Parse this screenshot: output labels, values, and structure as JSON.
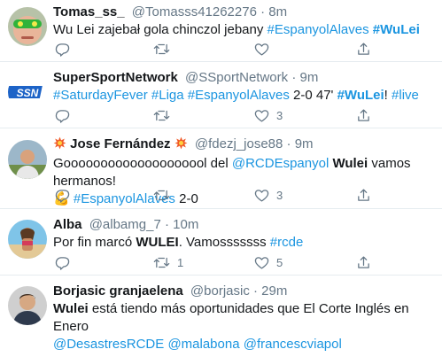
{
  "tweets": [
    {
      "name": "Tomas_ss_",
      "handle": "@Tomasss41262276",
      "time": "8m",
      "text": [
        {
          "t": "Wu Lei zajebał gola chinczol jebany "
        },
        {
          "t": "#EspanyolAlaves",
          "link": true
        },
        {
          "t": " "
        },
        {
          "t": "#WuLei",
          "link": true,
          "bold": true
        }
      ],
      "counts": {
        "reply": "",
        "retweet": "",
        "like": ""
      },
      "avatar": "avatar-green-mask"
    },
    {
      "name": "SuperSportNetwork",
      "handle": "@SSportNetwork",
      "time": "9m",
      "text": [
        {
          "t": "#SaturdayFever",
          "link": true
        },
        {
          "t": " "
        },
        {
          "t": "#Liga",
          "link": true
        },
        {
          "t": " "
        },
        {
          "t": "#EspanyolAlaves",
          "link": true
        },
        {
          "t": " 2-0 47' "
        },
        {
          "t": "#WuLei",
          "link": true,
          "bold": true
        },
        {
          "t": "! "
        },
        {
          "t": "#live",
          "link": true
        }
      ],
      "counts": {
        "reply": "",
        "retweet": "",
        "like": "3"
      },
      "avatar": "avatar-ssn-logo"
    },
    {
      "name": "Jose Fernández",
      "name_emoji": "💥",
      "handle": "@fdezj_jose88",
      "time": "9m",
      "text": [
        {
          "t": "Goooooooooooooooooool del "
        },
        {
          "t": "@RCDEspanyol",
          "link": true
        },
        {
          "t": " "
        },
        {
          "t": "Wulei",
          "bold": true
        },
        {
          "t": " vamos hermanos!"
        },
        {
          "br": true
        },
        {
          "t": "💪 ",
          "emoji": true
        },
        {
          "t": "#EspanyolAlaves",
          "link": true
        },
        {
          "t": " 2-0"
        }
      ],
      "counts": {
        "reply": "",
        "retweet": "",
        "like": "3"
      },
      "avatar": "avatar-man-outdoors"
    },
    {
      "name": "Alba",
      "handle": "@albamg_7",
      "time": "10m",
      "text": [
        {
          "t": "Por fin marcó "
        },
        {
          "t": "WULEI",
          "bold": true
        },
        {
          "t": ". Vamosssssss "
        },
        {
          "t": "#rcde",
          "link": true
        }
      ],
      "counts": {
        "reply": "",
        "retweet": "1",
        "like": "5"
      },
      "avatar": "avatar-beach-woman"
    },
    {
      "name": "Borjasic granjaelena",
      "handle": "@borjasic",
      "time": "29m",
      "text": [
        {
          "t": "Wulei",
          "bold": true
        },
        {
          "t": " está tiendo más oportunidades que El Corte Inglés en Enero"
        },
        {
          "br": true
        },
        {
          "t": "@DesastresRCDE",
          "link": true
        },
        {
          "t": " "
        },
        {
          "t": "@malabona",
          "link": true
        },
        {
          "t": " "
        },
        {
          "t": "@francescviapol",
          "link": true
        }
      ],
      "counts": {
        "reply": "",
        "retweet": "",
        "like": ""
      },
      "avatar": "avatar-man-portrait"
    }
  ],
  "colors": {
    "link": "#1b95e0",
    "secondary": "#657786",
    "text": "#14171a",
    "divider": "#e6ecf0"
  }
}
